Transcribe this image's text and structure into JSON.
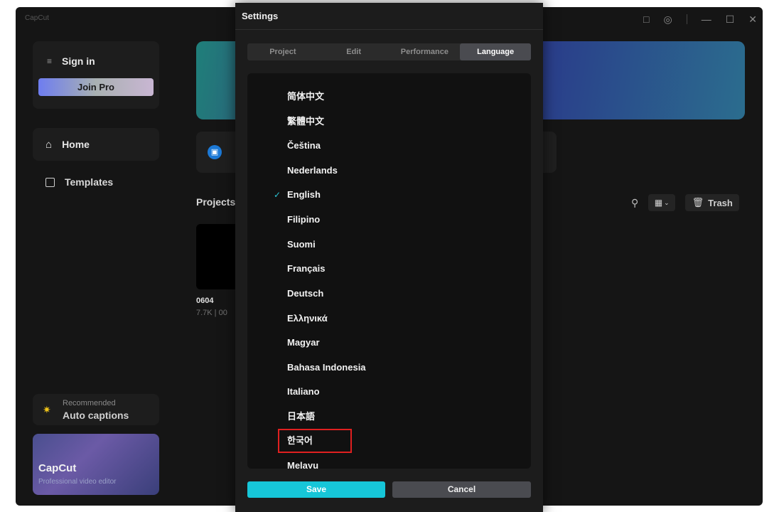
{
  "app": {
    "logo_small": "CapCut",
    "window_controls": {
      "feedback_icon": "chat-square-icon",
      "settings_icon": "gear-icon",
      "minimize": "—",
      "maximize": "☐",
      "close": "✕"
    }
  },
  "sidebar": {
    "sign_in": "Sign in",
    "join_pro": "Join Pro",
    "home": "Home",
    "templates": "Templates",
    "recommended_label": "Recommended",
    "recommended_title": "Auto captions",
    "promo_title": "CapCut",
    "promo_subtitle": "Professional video editor"
  },
  "main": {
    "projects_title": "Projects",
    "trash": "Trash",
    "project": {
      "name": "0604",
      "meta": "7.7K | 00"
    }
  },
  "dialog": {
    "title": "Settings",
    "tabs": [
      "Project",
      "Edit",
      "Performance",
      "Language"
    ],
    "active_tab": "Language",
    "languages": [
      "简体中文",
      "繁體中文",
      "Čeština",
      "Nederlands",
      "English",
      "Filipino",
      "Suomi",
      "Français",
      "Deutsch",
      "Ελληνικά",
      "Magyar",
      "Bahasa Indonesia",
      "Italiano",
      "日本語",
      "한국어",
      "Melayu"
    ],
    "selected_language": "English",
    "highlighted_language": "한국어",
    "save_label": "Save",
    "cancel_label": "Cancel"
  },
  "colors": {
    "accent": "#16c6d8",
    "highlight_border": "#e02020"
  }
}
